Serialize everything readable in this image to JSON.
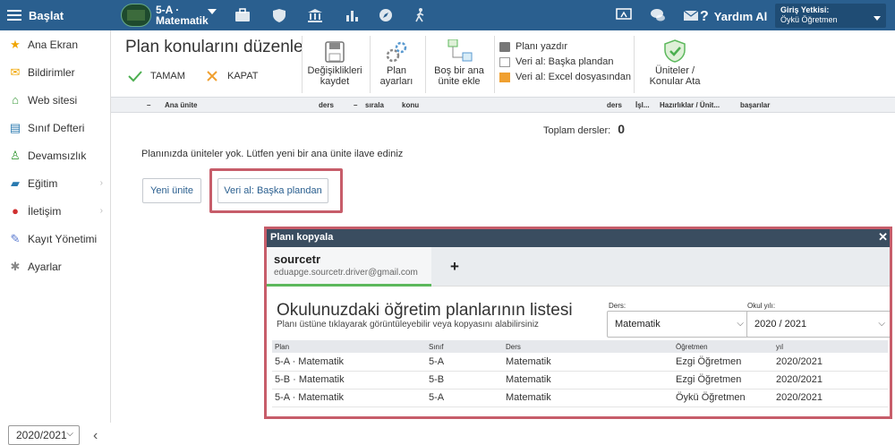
{
  "topbar": {
    "start_label": "Başlat",
    "class_name_line1": "5-A ·",
    "class_name_line2": "Matematik",
    "help_label": "Yardım Al",
    "login_title": "Giriş Yetkisi:",
    "login_user": "Öykü Öğretmen",
    "color": "#2a5f8f"
  },
  "sidebar": {
    "items": [
      {
        "label": "Ana Ekran",
        "icon": "star-icon",
        "color": "#f0a500"
      },
      {
        "label": "Bildirimler",
        "icon": "envelope-icon",
        "color": "#f0a500"
      },
      {
        "label": "Web sitesi",
        "icon": "home-icon",
        "color": "#3a9a3a"
      },
      {
        "label": "Sınıf Defteri",
        "icon": "notebook-icon",
        "color": "#2a7ab0"
      },
      {
        "label": "Devamsızlık",
        "icon": "person-icon",
        "color": "#3a9a3a"
      },
      {
        "label": "Eğitim",
        "icon": "graduation-icon",
        "color": "#2a7ab0"
      },
      {
        "label": "İletişim",
        "icon": "chat-icon",
        "color": "#d03030"
      },
      {
        "label": "Kayıt Yönetimi",
        "icon": "pen-icon",
        "color": "#5a7ad0"
      },
      {
        "label": "Ayarlar",
        "icon": "gear-icon",
        "color": "#888888"
      }
    ],
    "year": "2020/2021"
  },
  "header": {
    "title": "Plan konularını düzenle",
    "ok_label": "TAMAM",
    "close_label": "KAPAT",
    "save_label_1": "Değişiklikleri",
    "save_label_2": "kaydet",
    "settings_label_1": "Plan",
    "settings_label_2": "ayarları",
    "add_unit_label_1": "Boş bir ana",
    "add_unit_label_2": "ünite ekle",
    "print_label": "Planı yazdır",
    "import_plan_label": "Veri al: Başka plandan",
    "import_excel_label": "Veri al: Excel dosyasından",
    "assign_label_1": "Üniteler /",
    "assign_label_2": "Konular Ata"
  },
  "columns": {
    "ana_unite": "Ana ünite",
    "ders": "ders",
    "sirala": "sırala",
    "konu": "konu",
    "ders2": "ders",
    "isl": "İşl...",
    "hazir": "Hazırlıklar / Ünit...",
    "basarilar": "başarılar"
  },
  "summary": {
    "total_label": "Toplam dersler:",
    "total_value": "0"
  },
  "empty_message": "Planınızda üniteler yok. Lütfen yeni bir ana ünite ilave ediniz",
  "buttons": {
    "new_unit": "Yeni ünite",
    "import_other": "Veri al: Başka plandan"
  },
  "dialog": {
    "title": "Planı kopyala",
    "tab_name": "sourcetr",
    "tab_email": "eduapge.sourcetr.driver@gmail.com",
    "add_tab": "+",
    "heading": "Okulunuzdaki öğretim planlarının listesi",
    "subheading": "Planı üstüne tıklayarak görüntüleyebilir veya kopyasını alabilirsiniz",
    "subject_label": "Ders:",
    "subject_value": "Matematik",
    "year_label": "Okul yılı:",
    "year_value": "2020 / 2021",
    "table_headers": [
      "Plan",
      "Sınıf",
      "Ders",
      "Öğretmen",
      "yıl"
    ],
    "rows": [
      [
        "5-A · Matematik",
        "5-A",
        "Matematik",
        "Ezgi Öğretmen",
        "2020/2021"
      ],
      [
        "5-B · Matematik",
        "5-B",
        "Matematik",
        "Ezgi Öğretmen",
        "2020/2021"
      ],
      [
        "5-A · Matematik",
        "5-A",
        "Matematik",
        "Öykü Öğretmen",
        "2020/2021"
      ]
    ]
  }
}
